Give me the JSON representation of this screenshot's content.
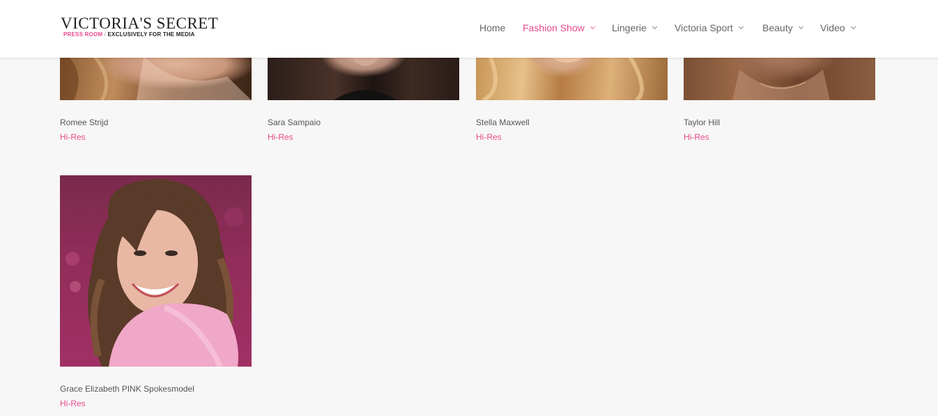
{
  "header": {
    "logo_main": "VICTORIA'S SECRET",
    "logo_sub_pink": "PRESS ROOM",
    "logo_sub_sep": " / ",
    "logo_sub_dark": "EXCLUSIVELY FOR THE MEDIA"
  },
  "nav": {
    "items": [
      {
        "label": "Home"
      },
      {
        "label": "Fashion Show"
      },
      {
        "label": "Lingerie"
      },
      {
        "label": "Victoria Sport"
      },
      {
        "label": "Beauty"
      },
      {
        "label": "Video"
      }
    ]
  },
  "models": [
    {
      "name": "Romee Strijd",
      "link": "Hi-Res"
    },
    {
      "name": "Sara Sampaio",
      "link": "Hi-Res"
    },
    {
      "name": "Stella Maxwell",
      "link": "Hi-Res"
    },
    {
      "name": "Taylor Hill",
      "link": "Hi-Res"
    },
    {
      "name": "Grace Elizabeth PINK Spokesmodel",
      "link": "Hi-Res"
    }
  ],
  "colors": {
    "accent": "#e94a8a",
    "background": "#f7f7f7",
    "text": "#555555"
  }
}
